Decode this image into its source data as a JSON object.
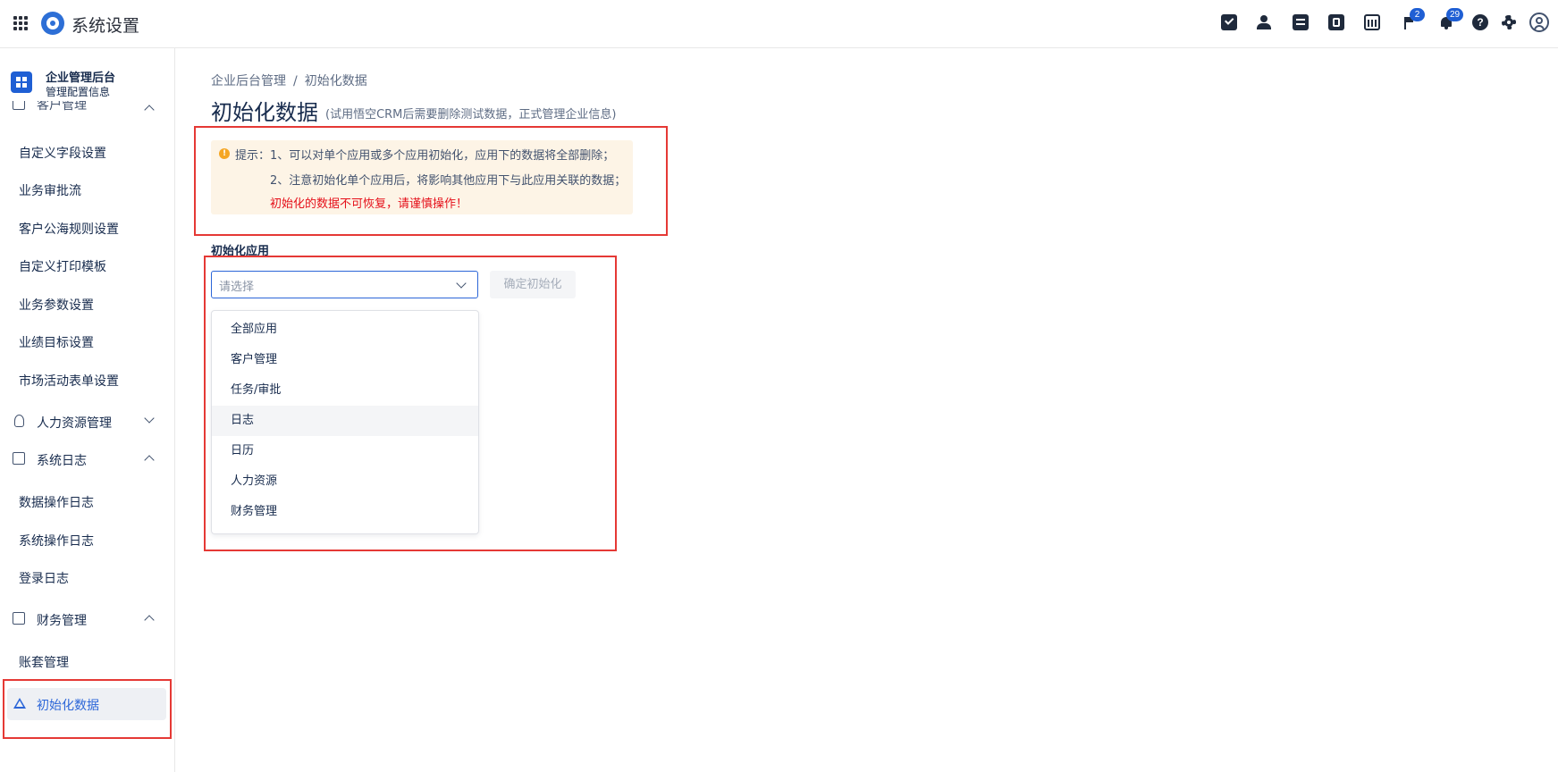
{
  "header": {
    "title": "系统设置",
    "badges": {
      "flag": "2",
      "bell": "29"
    }
  },
  "sidebar": {
    "title": "企业管理后台",
    "subtitle": "管理配置信息",
    "partial_group": "客户管理",
    "items_top": [
      "自定义字段设置",
      "业务审批流",
      "客户公海规则设置",
      "自定义打印模板",
      "业务参数设置",
      "业绩目标设置",
      "市场活动表单设置"
    ],
    "group_hr": "人力资源管理",
    "group_log": "系统日志",
    "items_log": [
      "数据操作日志",
      "系统操作日志",
      "登录日志"
    ],
    "group_finance": "财务管理",
    "items_finance": [
      "账套管理"
    ],
    "active": "初始化数据"
  },
  "main": {
    "breadcrumb": [
      "企业后台管理",
      "/",
      "初始化数据"
    ],
    "title": "初始化数据",
    "subtitle": "(试用悟空CRM后需要删除测试数据，正式管理企业信息)",
    "tip": {
      "prefix": "提示：",
      "line1": "1、可以对单个应用或多个应用初始化，应用下的数据将全部删除；",
      "line2": "2、注意初始化单个应用后，将影响其他应用下与此应用关联的数据；",
      "line3": "初始化的数据不可恢复，请谨慎操作！"
    },
    "section_label": "初始化应用",
    "select_placeholder": "请选择",
    "confirm_label": "确定初始化",
    "options": [
      "全部应用",
      "客户管理",
      "任务/审批",
      "日志",
      "日历",
      "人力资源",
      "财务管理"
    ],
    "hovered_option": "日志"
  },
  "colors": {
    "accent": "#2c66d8",
    "annotation": "#e53935",
    "warning_bg": "#fdf4e6",
    "warning_text": "#e5101a"
  }
}
